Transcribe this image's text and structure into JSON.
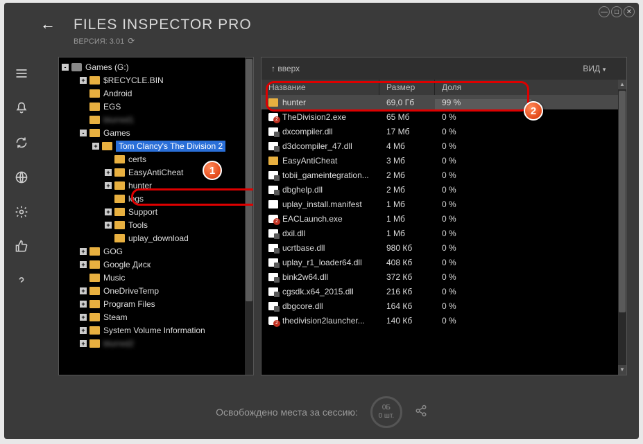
{
  "app": {
    "title": "FILES INSPECTOR PRO",
    "version_label": "ВЕРСИЯ: 3.01"
  },
  "window_controls": {
    "min": "—",
    "max": "□",
    "close": "✕"
  },
  "tree": {
    "root": {
      "label": "Games (G:)"
    },
    "items": [
      {
        "label": "$RECYCLE.BIN",
        "depth": 1,
        "exp": "+"
      },
      {
        "label": "Android",
        "depth": 1,
        "exp": ""
      },
      {
        "label": "EGS",
        "depth": 1,
        "exp": ""
      },
      {
        "label": "blurred1",
        "depth": 1,
        "exp": "",
        "blur": true
      },
      {
        "label": "Games",
        "depth": 1,
        "exp": "-"
      },
      {
        "label": "Tom Clancy's The Division 2",
        "depth": 2,
        "exp": "+",
        "selected": true
      },
      {
        "label": "certs",
        "depth": 3,
        "exp": ""
      },
      {
        "label": "EasyAntiCheat",
        "depth": 3,
        "exp": "+"
      },
      {
        "label": "hunter",
        "depth": 3,
        "exp": "+"
      },
      {
        "label": "logs",
        "depth": 3,
        "exp": ""
      },
      {
        "label": "Support",
        "depth": 3,
        "exp": "+"
      },
      {
        "label": "Tools",
        "depth": 3,
        "exp": "+"
      },
      {
        "label": "uplay_download",
        "depth": 3,
        "exp": ""
      },
      {
        "label": "GOG",
        "depth": 1,
        "exp": "+"
      },
      {
        "label": "Google Диск",
        "depth": 1,
        "exp": "+"
      },
      {
        "label": "Music",
        "depth": 1,
        "exp": ""
      },
      {
        "label": "OneDriveTemp",
        "depth": 1,
        "exp": "+"
      },
      {
        "label": "Program Files",
        "depth": 1,
        "exp": "+"
      },
      {
        "label": "Steam",
        "depth": 1,
        "exp": "+"
      },
      {
        "label": "System Volume Information",
        "depth": 1,
        "exp": "+"
      },
      {
        "label": "blurred2",
        "depth": 1,
        "exp": "+",
        "blur": true
      }
    ]
  },
  "list": {
    "up_label": "↑ вверх",
    "view_label": "ВИД",
    "headers": {
      "name": "Название",
      "size": "Размер",
      "share": "Доля"
    },
    "rows": [
      {
        "name": "hunter",
        "size": "69,0 Гб",
        "share": "99 %",
        "icon": "folder",
        "bar": 99,
        "selected": true
      },
      {
        "name": "TheDivision2.exe",
        "size": "65 Мб",
        "share": "0 %",
        "icon": "exe"
      },
      {
        "name": "dxcompiler.dll",
        "size": "17 Мб",
        "share": "0 %",
        "icon": "dll"
      },
      {
        "name": "d3dcompiler_47.dll",
        "size": "4 Мб",
        "share": "0 %",
        "icon": "dll"
      },
      {
        "name": "EasyAntiCheat",
        "size": "3 Мб",
        "share": "0 %",
        "icon": "folder"
      },
      {
        "name": "tobii_gameintegration...",
        "size": "2 Мб",
        "share": "0 %",
        "icon": "dll"
      },
      {
        "name": "dbghelp.dll",
        "size": "2 Мб",
        "share": "0 %",
        "icon": "dll"
      },
      {
        "name": "uplay_install.manifest",
        "size": "1 Мб",
        "share": "0 %",
        "icon": "file"
      },
      {
        "name": "EACLaunch.exe",
        "size": "1 Мб",
        "share": "0 %",
        "icon": "exe"
      },
      {
        "name": "dxil.dll",
        "size": "1 Мб",
        "share": "0 %",
        "icon": "dll"
      },
      {
        "name": "ucrtbase.dll",
        "size": "980 Кб",
        "share": "0 %",
        "icon": "dll"
      },
      {
        "name": "uplay_r1_loader64.dll",
        "size": "408 Кб",
        "share": "0 %",
        "icon": "dll"
      },
      {
        "name": "bink2w64.dll",
        "size": "372 Кб",
        "share": "0 %",
        "icon": "dll"
      },
      {
        "name": "cgsdk.x64_2015.dll",
        "size": "216 Кб",
        "share": "0 %",
        "icon": "dll"
      },
      {
        "name": "dbgcore.dll",
        "size": "164 Кб",
        "share": "0 %",
        "icon": "dll"
      },
      {
        "name": "thedivision2launcher...",
        "size": "140 Кб",
        "share": "0 %",
        "icon": "exe"
      }
    ]
  },
  "footer": {
    "label": "Освобождено места за сессию:",
    "bytes": "0Б",
    "count": "0 шт."
  },
  "callouts": {
    "one": "1",
    "two": "2"
  }
}
